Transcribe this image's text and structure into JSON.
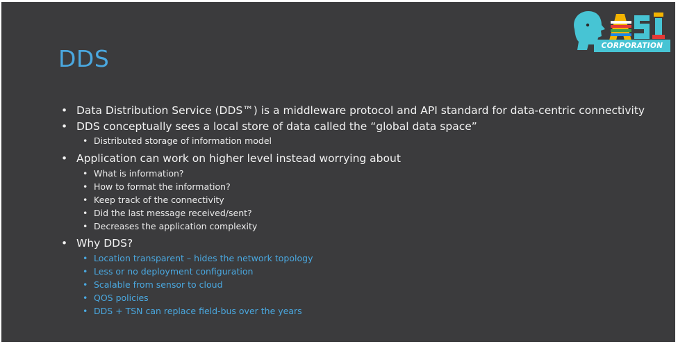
{
  "slide": {
    "title": "DDS",
    "logo": {
      "corporation_text": "CORPORATION"
    },
    "bullets": [
      {
        "text": "Data Distribution Service (DDS™) is a middleware protocol and API standard for data-centric connectivity",
        "children": []
      },
      {
        "text": "DDS conceptually sees a local store of data called the “global data space”",
        "children": [
          "Distributed storage of information model"
        ]
      },
      {
        "text": "Application can work on higher level instead worrying about",
        "children": [
          "What is information?",
          "How to format the information?",
          "Keep track of the connectivity",
          "Did the last message received/sent?",
          "Decreases the application complexity"
        ]
      },
      {
        "text": "Why DDS?",
        "children": [
          "Location transparent –  hides the network topology",
          "Less or no deployment configuration",
          "Scalable from sensor to cloud",
          "QOS policies",
          "DDS + TSN can replace field-bus over the years"
        ]
      }
    ]
  },
  "colors": {
    "background": "#3b3b3d",
    "title": "#4aa8e0",
    "highlight": "#4aa8e0",
    "text": "#f2f2f2"
  }
}
